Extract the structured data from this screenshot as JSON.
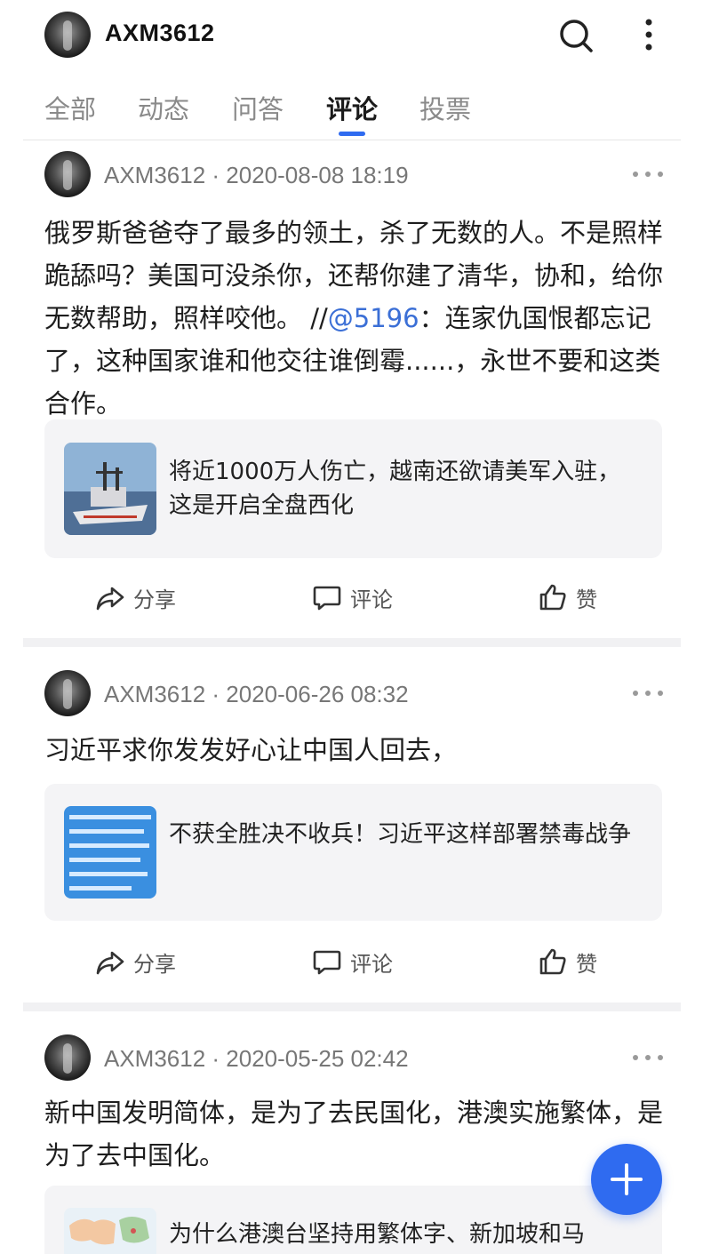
{
  "header": {
    "profile_name": "AXM3612",
    "icons": {
      "search": "search-icon",
      "more": "more-vertical-icon"
    }
  },
  "tabs": [
    {
      "label": "全部",
      "active": false
    },
    {
      "label": "动态",
      "active": false
    },
    {
      "label": "问答",
      "active": false
    },
    {
      "label": "评论",
      "active": true
    },
    {
      "label": "投票",
      "active": false
    }
  ],
  "posts": [
    {
      "author": "AXM3612",
      "meta": "AXM3612 · 2020-08-08 18:19",
      "text_before_mention": "俄罗斯爸爸夺了最多的领土，杀了无数的人。不是照样跪舔吗？美国可没杀你，还帮你建了清华，协和，给你无数帮助，照样咬他。 //",
      "mention": "@5196",
      "text_after_mention": "：连家仇国恨都忘记了，这种国家谁和他交往谁倒霉......，永世不要和这类合作。",
      "link_title": "将近1000万人伤亡，越南还欲请美军入驻，这是开启全盘西化",
      "thumb": "warship-image",
      "actions": {
        "share": "分享",
        "comment": "评论",
        "like": "赞"
      }
    },
    {
      "author": "AXM3612",
      "meta": "AXM3612 · 2020-06-26 08:32",
      "text": "习近平求你发发好心让中国人回去，",
      "link_title": "不获全胜决不收兵！习近平这样部署禁毒战争",
      "thumb": "text-poster-image",
      "actions": {
        "share": "分享",
        "comment": "评论",
        "like": "赞"
      }
    },
    {
      "author": "AXM3612",
      "meta": "AXM3612 · 2020-05-25 02:42",
      "text": "新中国发明简体，是为了去民国化，港澳实施繁体，是为了去中国化。",
      "link_title": "为什么港澳台坚持用繁体字、新加坡和马",
      "thumb": "map-image"
    }
  ],
  "colors": {
    "accent": "#2f6bf0",
    "mention": "#3b6fd6",
    "card_bg": "#f4f4f6"
  },
  "fab": {
    "icon": "plus-icon"
  }
}
